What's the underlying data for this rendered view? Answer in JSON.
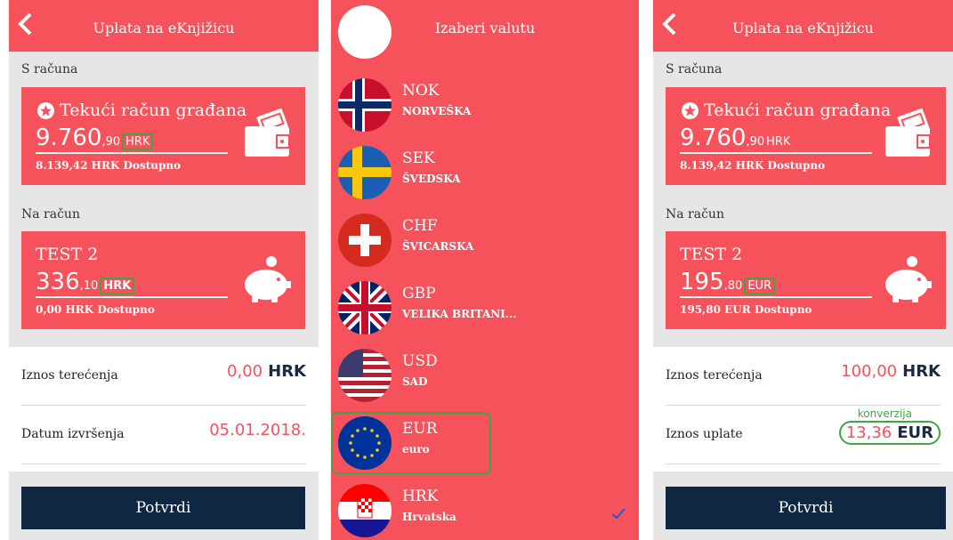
{
  "screen1": {
    "title": "Uplata na eKnjižicu",
    "from_label": "S računa",
    "from_card": {
      "name": "Tekući račun građana",
      "amount_main": "9.760",
      "amount_decimal": ",90",
      "currency": "HRK",
      "available": "8.139,42 HRK Dostupno"
    },
    "to_label": "Na račun",
    "to_card": {
      "name": "TEST 2",
      "amount_main": "336",
      "amount_decimal": ",10",
      "currency": "HRK",
      "available": "0,00 HRK Dostupno"
    },
    "debit_label": "Iznos terećenja",
    "debit_value": "0,00",
    "debit_currency": "HRK",
    "date_label": "Datum izvršenja",
    "date_value": "05.01.2018.",
    "confirm_label": "Potvrdi"
  },
  "screen2": {
    "title": "Izaberi valutu",
    "currencies": [
      {
        "code": "NOK",
        "country": "NORVEŠKA",
        "flag": "norway-flag"
      },
      {
        "code": "SEK",
        "country": "ŠVEDSKA",
        "flag": "sweden-flag"
      },
      {
        "code": "CHF",
        "country": "ŠVICARSKA",
        "flag": "switzerland-flag"
      },
      {
        "code": "GBP",
        "country": "VELIKA BRITANI...",
        "flag": "uk-flag"
      },
      {
        "code": "USD",
        "country": "SAD",
        "flag": "usa-flag"
      },
      {
        "code": "EUR",
        "country": "euro",
        "flag": "eu-flag"
      },
      {
        "code": "HRK",
        "country": "Hrvatska",
        "flag": "croatia-flag",
        "selected": true
      }
    ]
  },
  "screen3": {
    "title": "Uplata na eKnjižicu",
    "from_label": "S računa",
    "from_card": {
      "name": "Tekući račun građana",
      "amount_main": "9.760",
      "amount_decimal": ",90",
      "currency": "HRK",
      "available": "8.139,42 HRK Dostupno"
    },
    "to_label": "Na račun",
    "to_card": {
      "name": "TEST 2",
      "amount_main": "195",
      "amount_decimal": ",80",
      "currency": "EUR",
      "available": "195,80 EUR Dostupno"
    },
    "debit_label": "Iznos terećenja",
    "debit_value": "100,00",
    "debit_currency": "HRK",
    "conversion_note": "konverzija",
    "payment_label": "Iznos uplate",
    "payment_value": "13,36",
    "payment_currency": "EUR",
    "confirm_label": "Potvrdi"
  },
  "colors": {
    "accent": "#f5525b",
    "navy": "#0f2740",
    "highlight_green": "#3ea644",
    "background": "#e6e6e6"
  }
}
